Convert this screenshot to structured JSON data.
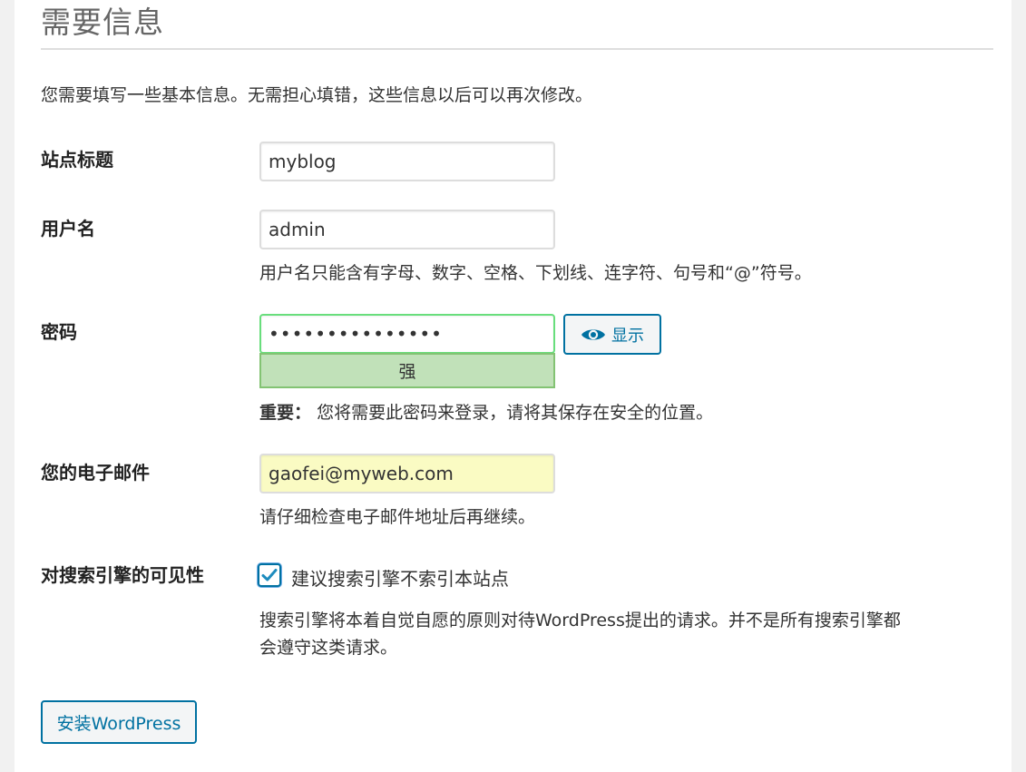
{
  "page": {
    "title": "需要信息",
    "intro": "您需要填写一些基本信息。无需担心填错，这些信息以后可以再次修改。"
  },
  "site_title": {
    "label": "站点标题",
    "value": "myblog"
  },
  "username": {
    "label": "用户名",
    "value": "admin",
    "hint": "用户名只能含有字母、数字、空格、下划线、连字符、句号和“@”符号。"
  },
  "password": {
    "label": "密码",
    "value": "•••••••••••••••",
    "show_label": "显示",
    "strength": "强",
    "note_strong": "重要：",
    "note_text": "您将需要此密码来登录，请将其保存在安全的位置。"
  },
  "email": {
    "label": "您的电子邮件",
    "value": "gaofei@myweb.com",
    "hint": "请仔细检查电子邮件地址后再继续。"
  },
  "visibility": {
    "label": "对搜索引擎的可见性",
    "checkbox_label": "建议搜索引擎不索引本站点",
    "checked": true,
    "hint_line1": "搜索引擎将本着自觉自愿的原则对待WordPress提出的请求。并不是所有搜索引擎都",
    "hint_line2": "会遵守这类请求。"
  },
  "install_button": "安装WordPress",
  "colors": {
    "accent": "#0071a1",
    "strength_bg": "#c1e1b9",
    "strength_border": "#83c373",
    "autofill_bg": "#fafbc3"
  }
}
